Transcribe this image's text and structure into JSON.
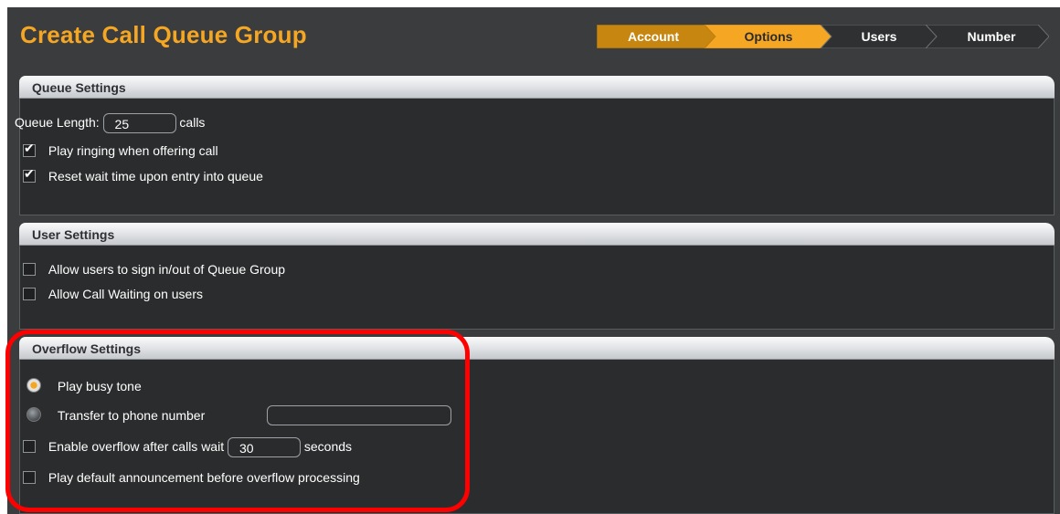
{
  "header": {
    "title": "Create Call Queue Group"
  },
  "wizard": {
    "steps": [
      {
        "label": "Account",
        "state": "completed"
      },
      {
        "label": "Options",
        "state": "active"
      },
      {
        "label": "Users",
        "state": "upcoming"
      },
      {
        "label": "Number",
        "state": "upcoming"
      }
    ]
  },
  "queue_settings": {
    "title": "Queue Settings",
    "queue_length_label": "Queue Length:",
    "queue_length_value": "25",
    "queue_length_unit": "calls",
    "options": [
      {
        "label": "Play ringing when offering call",
        "checked": true
      },
      {
        "label": "Reset wait time upon entry into queue",
        "checked": true
      }
    ]
  },
  "user_settings": {
    "title": "User Settings",
    "options": [
      {
        "label": "Allow users to sign in/out of Queue Group",
        "checked": false
      },
      {
        "label": "Allow Call Waiting on users",
        "checked": false
      }
    ]
  },
  "overflow_settings": {
    "title": "Overflow Settings",
    "radio_busy": {
      "label": "Play busy tone",
      "selected": true
    },
    "radio_transfer": {
      "label": "Transfer to phone number",
      "selected": false
    },
    "transfer_number_value": "",
    "enable_overflow": {
      "label": "Enable overflow after calls wait",
      "checked": false
    },
    "wait_value": "30",
    "wait_unit": "seconds",
    "announcement": {
      "label": "Play default announcement before overflow processing",
      "checked": false
    }
  },
  "colors": {
    "accent": "#f5a623",
    "completed_step": "#c7860f",
    "background": "#3a3c3e",
    "panel_body": "#2b2c2d",
    "highlight": "#ff0000"
  }
}
